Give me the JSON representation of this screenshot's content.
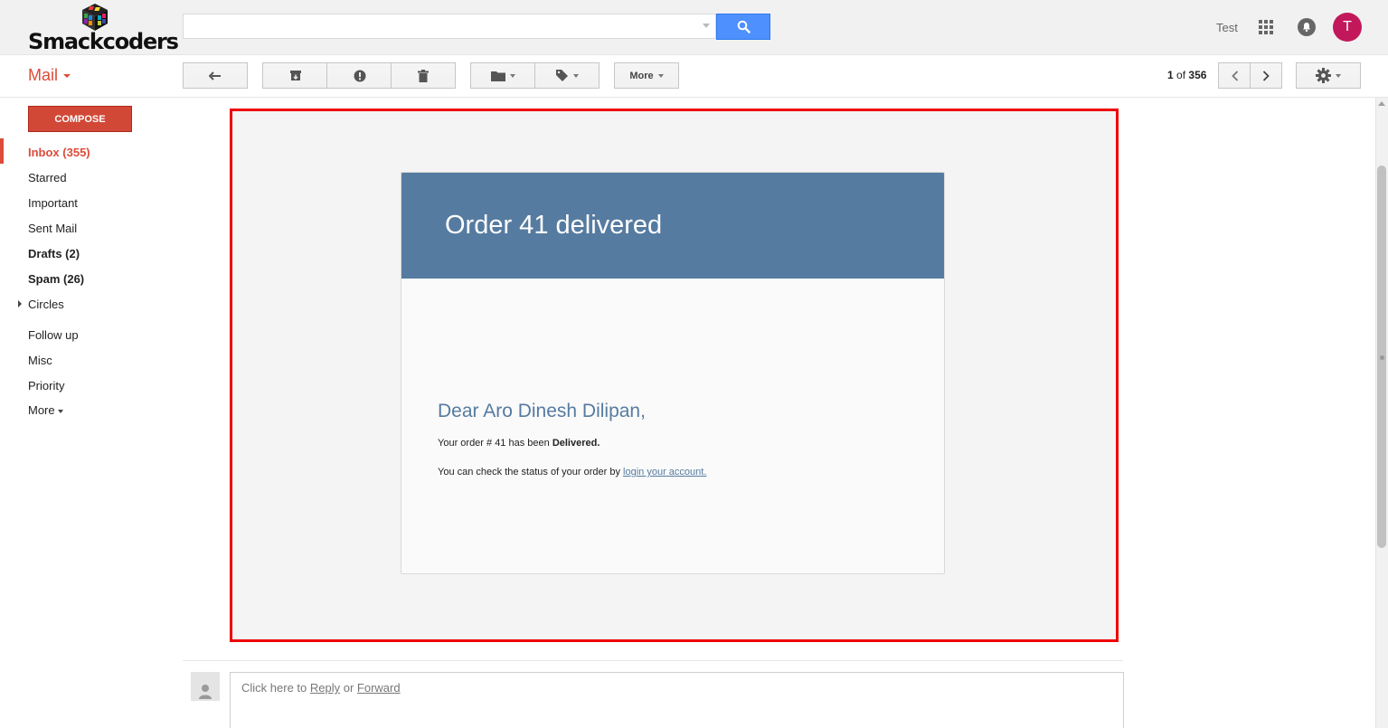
{
  "header": {
    "logo_text": "Smackcoders",
    "search": {
      "value": "",
      "placeholder": ""
    },
    "user_name": "Test",
    "avatar_letter": "T",
    "icons": [
      "search-icon",
      "apps-grid-icon",
      "notifications-icon"
    ]
  },
  "toolbar": {
    "app_label": "Mail",
    "more_label": "More",
    "pager": {
      "current": "1",
      "of_label": "of",
      "total": "356"
    },
    "icons": [
      "reply-icon",
      "archive-icon",
      "report-spam-icon",
      "delete-icon",
      "folder-icon",
      "label-icon",
      "chevron-left-icon",
      "chevron-right-icon",
      "gear-icon"
    ]
  },
  "sidebar": {
    "compose_label": "COMPOSE",
    "items": [
      {
        "label": "Inbox (355)",
        "state": "active"
      },
      {
        "label": "Starred",
        "state": "normal"
      },
      {
        "label": "Important",
        "state": "normal"
      },
      {
        "label": "Sent Mail",
        "state": "normal"
      },
      {
        "label": "Drafts (2)",
        "state": "bold"
      },
      {
        "label": "Spam (26)",
        "state": "bold"
      },
      {
        "label": "Circles",
        "state": "expandable"
      },
      {
        "label": "Follow up",
        "state": "normal"
      },
      {
        "label": "Misc",
        "state": "normal"
      },
      {
        "label": "Priority",
        "state": "normal"
      },
      {
        "label": "More",
        "state": "dropdown"
      }
    ]
  },
  "email": {
    "title": "Order 41 delivered",
    "greeting": "Dear Aro Dinesh Dilipan,",
    "line1_prefix": "Your order # 41 has been ",
    "line1_status": "Delivered.",
    "line2_prefix": "You can check the status of your order by ",
    "line2_link": "login your account.",
    "header_color": "#567ba0",
    "frame_color": "#ee0000"
  },
  "reply": {
    "prefix": "Click here to ",
    "reply_link": "Reply",
    "or_text": " or ",
    "forward_link": "Forward"
  },
  "colors": {
    "accent_red": "#dd4b39",
    "search_blue": "#4d90fe",
    "avatar_bg": "#c2185b"
  }
}
